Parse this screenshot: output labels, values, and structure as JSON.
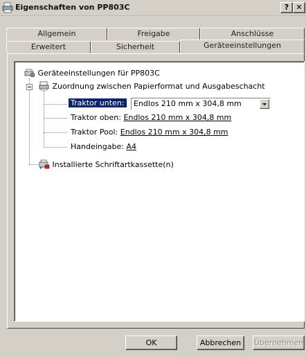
{
  "window": {
    "title": "Eigenschaften von PP803C",
    "help_label": "?",
    "close_label": "✕"
  },
  "tabs": {
    "back_row": [
      "Allgemein",
      "Freigabe",
      "Anschlüsse"
    ],
    "front_row": [
      "Erweitert",
      "Sicherheit",
      "Geräteeinstellungen"
    ],
    "active": "Geräteeinstellungen"
  },
  "tree": {
    "root": "Geräteeinstellungen für PP803C",
    "group": "Zuordnung zwischen Papierformat und Ausgabeschacht",
    "items": [
      {
        "label": "Traktor unten:",
        "value": "Endlos 210 mm x 304,8 mm"
      },
      {
        "label": "Traktor oben:",
        "value": "Endlos 210 mm x 304,8 mm"
      },
      {
        "label": "Traktor Pool:",
        "value": "Endlos 210 mm x 304,8 mm"
      },
      {
        "label": "Handeingabe:",
        "value": "A4"
      }
    ],
    "fonts": "Installierte Schriftartkassette(n)"
  },
  "buttons": {
    "ok": "OK",
    "cancel": "Abbrechen",
    "apply": "Übernehmen"
  },
  "icons": {
    "title": "printer-icon",
    "root": "printer-settings-icon",
    "group": "paper-tray-icon",
    "fonts": "font-cartridge-icon"
  }
}
